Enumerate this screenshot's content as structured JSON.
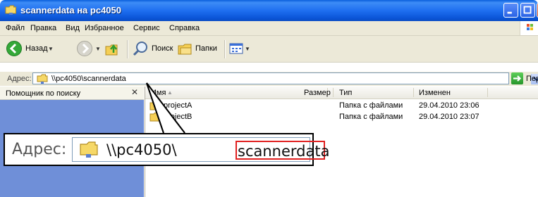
{
  "window": {
    "title": "scannerdata на pc4050"
  },
  "menu": [
    "Файл",
    "Правка",
    "Вид",
    "Избранное",
    "Сервис",
    "Справка"
  ],
  "toolbar": {
    "back_label": "Назад",
    "search_label": "Поиск",
    "folders_label": "Папки"
  },
  "address": {
    "label": "Адрес:",
    "value": "\\\\pc4050\\scannerdata",
    "go_label": "Переход"
  },
  "left_panel": {
    "title": "Помощник по поиску"
  },
  "columns": {
    "name": "Имя",
    "size": "Размер",
    "type": "Тип",
    "modified": "Изменен"
  },
  "files": [
    {
      "name": "projectA",
      "size": "",
      "type": "Папка с файлами",
      "modified": "29.04.2010 23:06"
    },
    {
      "name": "projectB",
      "size": "",
      "type": "Папка с файлами",
      "modified": "29.04.2010 23:07"
    }
  ],
  "callout": {
    "label": "Адрес:",
    "path_prefix": "\\\\pc4050\\",
    "path_highlight": "scannerdata"
  },
  "colors": {
    "titlebar": "#0b55d8",
    "highlight_border": "#e02020",
    "left_panel_bg": "#6f8fd8"
  }
}
